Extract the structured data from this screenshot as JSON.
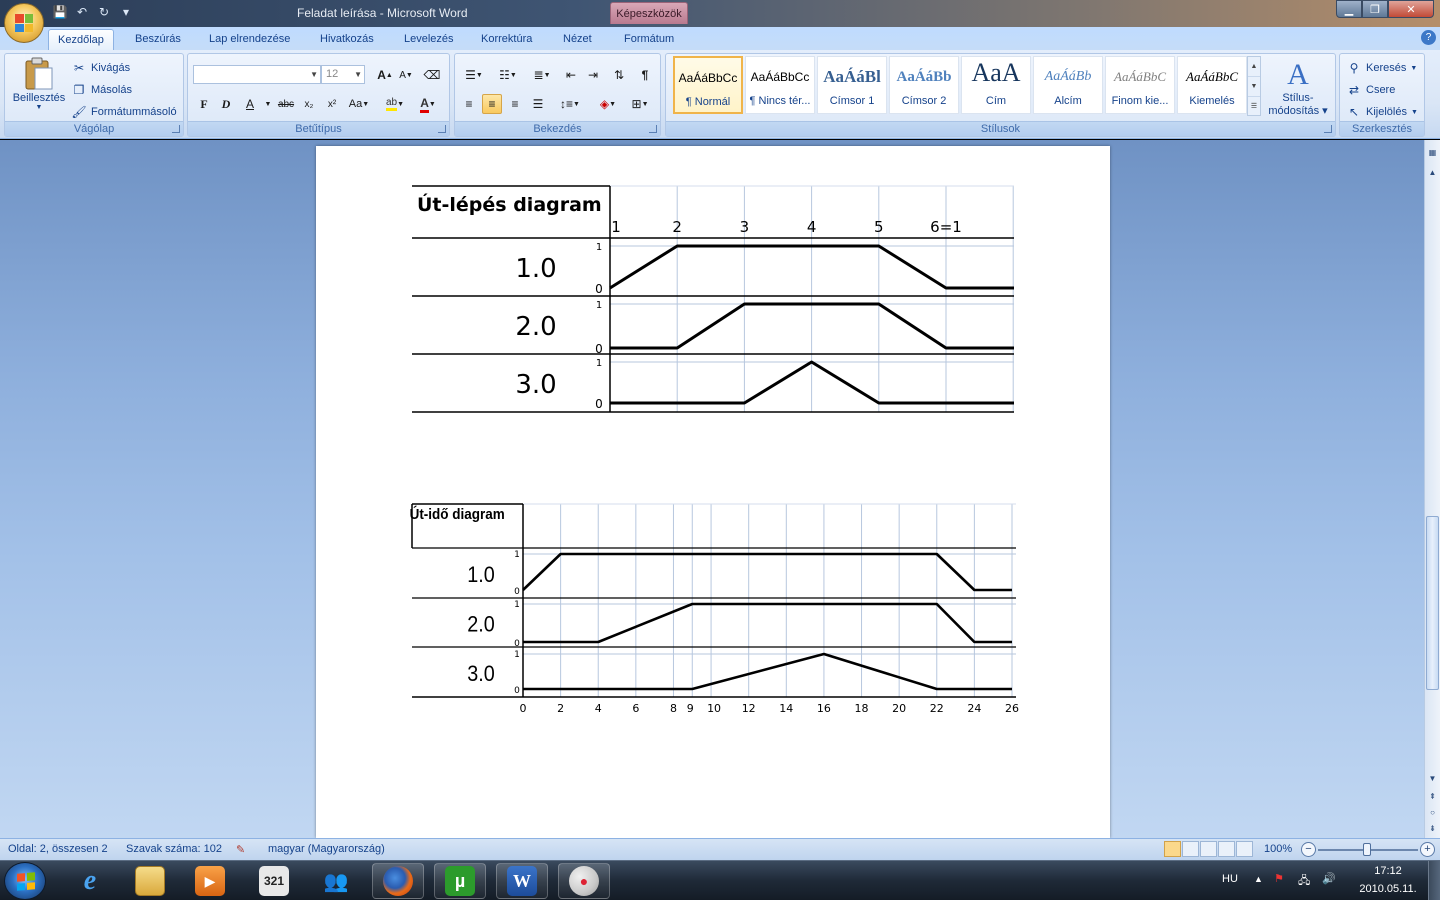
{
  "window": {
    "title": "Feladat leírása - Microsoft Word",
    "context_tab_title": "Képeszközök"
  },
  "ribbon": {
    "tabs": [
      "Kezdőlap",
      "Beszúrás",
      "Lap elrendezése",
      "Hivatkozás",
      "Levelezés",
      "Korrektúra",
      "Nézet",
      "Formátum"
    ],
    "active_tab": "Kezdőlap",
    "clipboard": {
      "paste": "Beillesztés",
      "cut": "Kivágás",
      "copy": "Másolás",
      "format_painter": "Formátummásoló",
      "label": "Vágólap"
    },
    "font": {
      "font_name": "",
      "font_size": "12",
      "bold": "F",
      "italic": "D",
      "underline": "A",
      "strike": "abc",
      "subscript": "x₂",
      "superscript": "x²",
      "case": "Aa",
      "grow": "A",
      "shrink": "A",
      "label": "Betűtípus"
    },
    "paragraph": {
      "label": "Bekezdés",
      "pilcrow": "¶"
    },
    "styles": {
      "items": [
        {
          "sample": "AaÁáBbCc",
          "name": "¶ Normál"
        },
        {
          "sample": "AaÁáBbCc",
          "name": "¶ Nincs tér..."
        },
        {
          "sample": "AaÁáBl",
          "name": "Címsor 1"
        },
        {
          "sample": "AaÁáBb",
          "name": "Címsor 2"
        },
        {
          "sample": "AaA",
          "name": "Cím"
        },
        {
          "sample": "AaÁáBb",
          "name": "Alcím"
        },
        {
          "sample": "AaÁáBbC",
          "name": "Finom kie..."
        },
        {
          "sample": "AaÁáBbC",
          "name": "Kiemelés"
        }
      ],
      "change_styles_1": "Stílus-",
      "change_styles_2": "módosítás",
      "label": "Stílusok"
    },
    "editing": {
      "find": "Keresés",
      "replace": "Csere",
      "select": "Kijelölés",
      "label": "Szerkesztés"
    }
  },
  "document": {
    "diagram1": {
      "title": "Út-lépés diagram",
      "steps": [
        "1",
        "2",
        "3",
        "4",
        "5",
        "6=1"
      ],
      "rows": [
        "1.0",
        "2.0",
        "3.0"
      ],
      "lo": "0",
      "hi": "1"
    },
    "diagram2": {
      "title": "Út-idő diagram",
      "rows": [
        "1.0",
        "2.0",
        "3.0"
      ],
      "lo": "0",
      "hi": "1",
      "time_ticks": [
        "0",
        "2",
        "4",
        "6",
        "8",
        "9",
        "10",
        "12",
        "14",
        "16",
        "18",
        "20",
        "22",
        "24",
        "26"
      ]
    }
  },
  "chart_data": [
    {
      "type": "line",
      "title": "Út-lépés diagram",
      "x": [
        "1",
        "2",
        "3",
        "4",
        "5",
        "6=1"
      ],
      "series": [
        {
          "name": "1.0",
          "values": [
            0,
            1,
            1,
            1,
            1,
            0,
            0
          ]
        },
        {
          "name": "2.0",
          "values": [
            0,
            0,
            1,
            1,
            1,
            0,
            0
          ]
        },
        {
          "name": "3.0",
          "values": [
            0,
            0,
            0,
            1,
            0,
            0,
            0
          ]
        }
      ],
      "ylim": [
        0,
        1
      ]
    },
    {
      "type": "line",
      "title": "Út-idő diagram",
      "x": [
        0,
        2,
        4,
        9,
        16,
        22,
        24,
        26
      ],
      "series": [
        {
          "name": "1.0",
          "points": [
            [
              0,
              0
            ],
            [
              2,
              1
            ],
            [
              22,
              1
            ],
            [
              24,
              0
            ],
            [
              26,
              0
            ]
          ]
        },
        {
          "name": "2.0",
          "points": [
            [
              0,
              0
            ],
            [
              4,
              0
            ],
            [
              9,
              1
            ],
            [
              22,
              1
            ],
            [
              24,
              0
            ],
            [
              26,
              0
            ]
          ]
        },
        {
          "name": "3.0",
          "points": [
            [
              0,
              0
            ],
            [
              9,
              0
            ],
            [
              16,
              1
            ],
            [
              22,
              0
            ],
            [
              26,
              0
            ]
          ]
        }
      ],
      "ylim": [
        0,
        1
      ],
      "xlim": [
        0,
        26
      ]
    }
  ],
  "statusbar": {
    "page": "Oldal: 2, összesen 2",
    "words": "Szavak száma: 102",
    "language": "magyar (Magyarország)",
    "zoom": "100%"
  },
  "taskbar": {
    "lang": "HU",
    "time": "17:12",
    "date": "2010.05.11."
  }
}
